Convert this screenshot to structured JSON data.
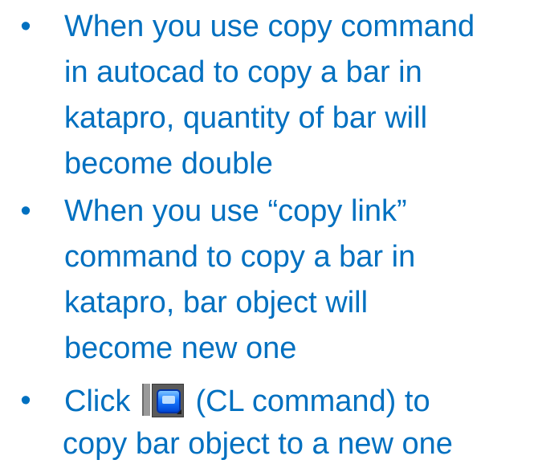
{
  "bullets": [
    {
      "marker": "•",
      "lines": [
        "When you use copy command",
        "in autocad to copy a bar in",
        "katapro, quantity of bar will",
        "become double"
      ]
    },
    {
      "marker": "•",
      "lines": [
        "When you use “copy link”",
        "command to copy a bar in",
        "katapro, bar object will",
        "become new one"
      ]
    },
    {
      "marker": "•",
      "line1_before_icon": "Click",
      "line1_after_icon": "(CL command) to",
      "line2": "copy bar object to a new one",
      "icon": "copy-link-icon"
    }
  ],
  "colors": {
    "text": "#0070c0",
    "background": "#ffffff"
  }
}
